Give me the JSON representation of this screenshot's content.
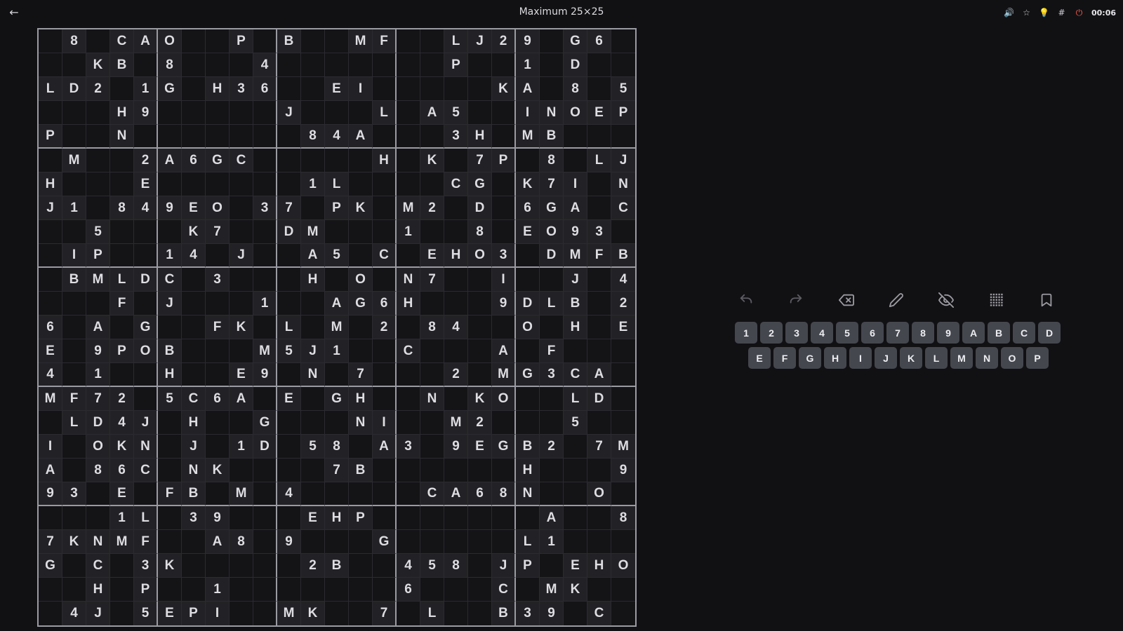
{
  "header": {
    "title": "Maximum 25×25",
    "back_icon": "←",
    "icons": [
      {
        "name": "sound-icon",
        "glyph": "🔊"
      },
      {
        "name": "star-icon",
        "glyph": "☆"
      },
      {
        "name": "hint-bulb-icon",
        "glyph": "💡"
      },
      {
        "name": "grid-number-icon",
        "glyph": "#"
      },
      {
        "name": "power-icon",
        "glyph": "⏻"
      }
    ],
    "timer": "00:06"
  },
  "board": {
    "rows": [
      ".8.CA|O..P.|B..MF|..LJ2|9.G6.",
      "..KB.|8...4|.....|..P..|1.D..",
      "LD2.1|G.H36|..EI.|....K|A.8.5",
      "...H9|.....|J...L|.A5..|INOEP",
      "P..N.|.....|.84A.|..3H.|MB...",
      ".M..2|A6GC.|....H|.K.7P|.8.LJ",
      "H...E|.....|.1L..|..CG.|K7I.N",
      "J1.84|9EO.3|7.PK.|M2.D.|6GA.C",
      "..5..|.K7..|DM...|1..8.|EO93.",
      ".IP..|14.J.|.A5.C|.EHO3|.DMFB",
      ".BMLD|C.3..|.H.O.|N7..I|..J.4",
      "...F.|J...1|..AG6|H...9|DLB.2",
      "6.A.G|..FK.|L.M.2|.84..|O.H.E",
      "E.9PO|B...M|5J1..|C...A|.F...",
      "4.1..|H..E9|.N.7.|..2.M|G3CA.",
      "MF72.|5C6A.|E.GH.|.N.KO|..LD.",
      ".LD4J|.H..G|...NI|..M2.|..5..",
      "I.OKN|.J.1D|.58.A|3.9EG|B2.7M",
      "A.86C|.NK..|..7B.|.....|H...9",
      "93.E.|FB.M.|4....|.CA68|N..O.",
      "...1L|.39..|.EHP.|.....|.A..8",
      "7KNMF|..A8.|9...G|.....|L1...",
      "G.C.3|K....|.2B..|458.J|P.EHO",
      "..H.P|..1..|.....|6...C|.MK..",
      ".4J.5|EPI..|MK..7|.L..B|39.C."
    ]
  },
  "toolbar": [
    {
      "name": "undo-button",
      "label": "Undo",
      "icon": "undo-icon",
      "dim": true
    },
    {
      "name": "redo-button",
      "label": "Redo",
      "icon": "redo-icon",
      "dim": true
    },
    {
      "name": "erase-button",
      "label": "Erase",
      "icon": "backspace-icon",
      "dim": false
    },
    {
      "name": "pencil-button",
      "label": "Notes",
      "icon": "pencil-icon",
      "dim": false
    },
    {
      "name": "hide-button",
      "label": "Hide",
      "icon": "eye-off-icon",
      "dim": false
    },
    {
      "name": "grid-button",
      "label": "Grid",
      "icon": "grid-icon",
      "dim": false
    },
    {
      "name": "bookmark-button",
      "label": "Bookmark",
      "icon": "bookmark-icon",
      "dim": false
    }
  ],
  "keypad": {
    "row1": [
      "1",
      "2",
      "3",
      "4",
      "5",
      "6",
      "7",
      "8",
      "9",
      "A",
      "B",
      "C",
      "D"
    ],
    "row2": [
      "E",
      "F",
      "G",
      "H",
      "I",
      "J",
      "K",
      "L",
      "M",
      "N",
      "O",
      "P"
    ]
  }
}
